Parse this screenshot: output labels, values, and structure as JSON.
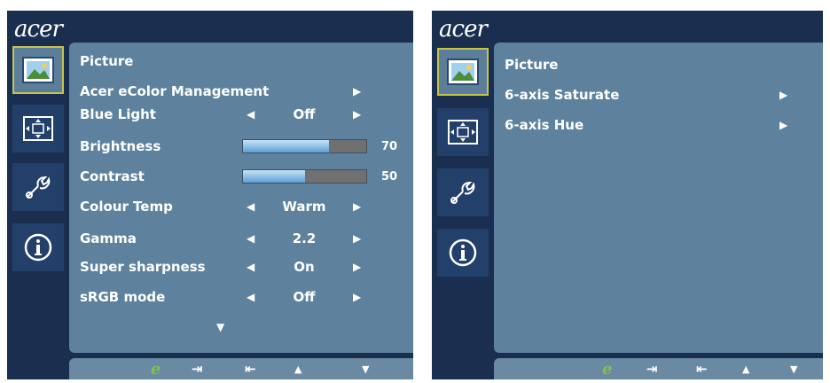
{
  "left_osd": {
    "brand": "acer",
    "section_title": "Picture",
    "items": [
      {
        "label": "Acer eColor Management"
      },
      {
        "label": "Blue Light",
        "value": "Off"
      },
      {
        "label": "Brightness",
        "value": "70",
        "level_percent": 70
      },
      {
        "label": "Contrast",
        "value": "50",
        "level_percent": 50
      },
      {
        "label": "Colour Temp",
        "value": "Warm"
      },
      {
        "label": "Gamma",
        "value": "2.2"
      },
      {
        "label": "Super sharpness",
        "value": "On"
      },
      {
        "label": "sRGB mode",
        "value": "Off"
      }
    ]
  },
  "right_osd": {
    "brand": "acer",
    "section_title": "Picture",
    "items": [
      {
        "label": "6-axis Saturate"
      },
      {
        "label": "6-axis Hue"
      }
    ]
  },
  "icons": {
    "tabs": [
      "picture-icon",
      "position-icon",
      "settings-wrench-icon",
      "info-icon"
    ],
    "footer": [
      "eco-mode-icon",
      "enter-icon",
      "exit-icon",
      "up-arrow-icon",
      "down-arrow-icon"
    ]
  },
  "colors": {
    "osd_background": "#1a2e4f",
    "content_panel": "#5e829d",
    "active_tab_border": "#c8c34a",
    "bar_fill": "#5aa0d6",
    "eco_icon": "#7ec34b"
  }
}
